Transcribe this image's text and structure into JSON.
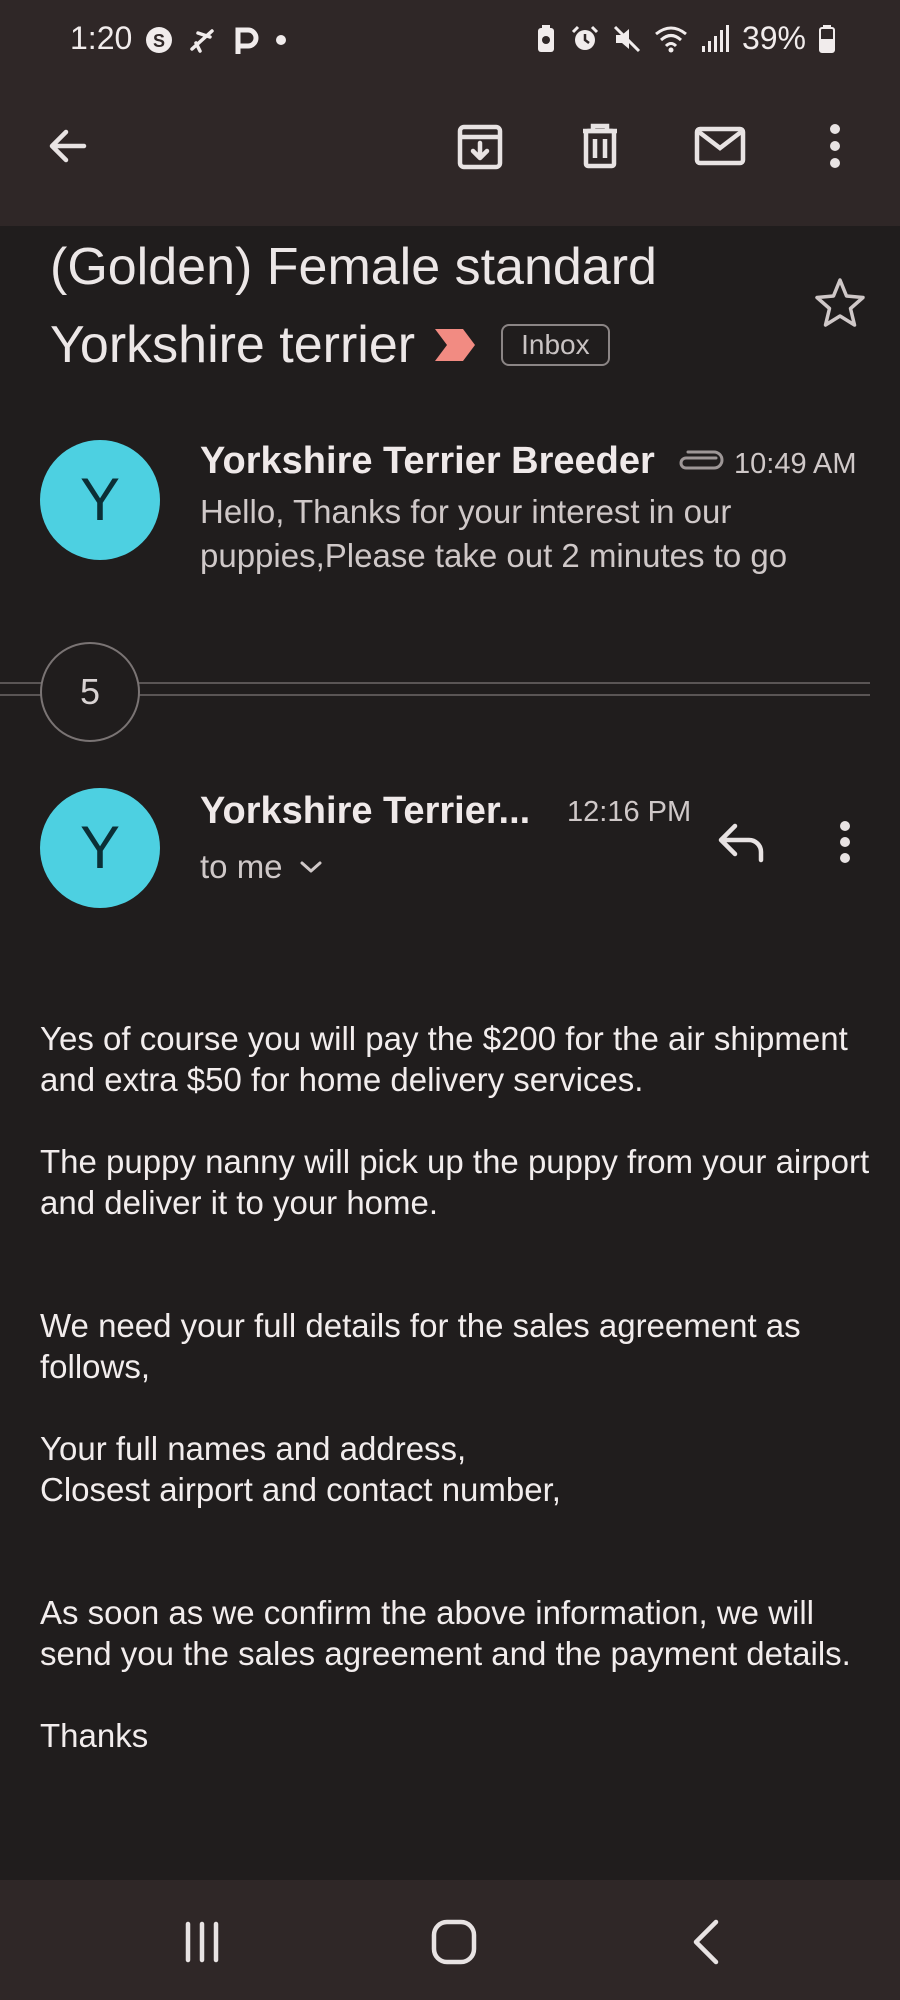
{
  "status_bar": {
    "time": "1:20",
    "left_icons": [
      "s-circle-icon",
      "flight-icon",
      "p-app-icon",
      "dot-icon"
    ],
    "right_icons": [
      "battery-saver-icon",
      "alarm-icon",
      "mute-icon",
      "wifi-icon",
      "signal-icon"
    ],
    "battery_percent": "39%"
  },
  "toolbar": {
    "back_icon": "arrow-back-icon",
    "actions": [
      "archive-icon",
      "delete-icon",
      "mark-unread-icon",
      "more-vert-icon"
    ]
  },
  "email": {
    "subject_line1": "(Golden) Female standard",
    "subject_line2": "Yorkshire terrier",
    "label": "Inbox",
    "important_marker_color": "#f28b82"
  },
  "collapsed_message": {
    "avatar_letter": "Y",
    "sender": "Yorkshire Terrier Breeder",
    "time": "10:49 AM",
    "snippet": "Hello, Thanks for your interest in our puppies,Please take out 2 minutes to go"
  },
  "hidden_count": "5",
  "expanded_message": {
    "avatar_letter": "Y",
    "sender": "Yorkshire Terrier...",
    "time": "12:16 PM",
    "recipient": "to me",
    "body": [
      "Yes of course you will pay the $200 for the air shipment and extra $50 for home delivery services.",
      "The puppy nanny will pick up the puppy from your airport and deliver it to your home.",
      "We need your full details for the sales agreement as follows,",
      "Your full names and address,",
      "Closest airport and contact number,",
      "As soon as we confirm the above information, we will send you the sales agreement and the payment details.",
      "Thanks"
    ]
  },
  "colors": {
    "background": "#201d1d",
    "bar": "#2f2727",
    "avatar": "#4dd0e1"
  }
}
